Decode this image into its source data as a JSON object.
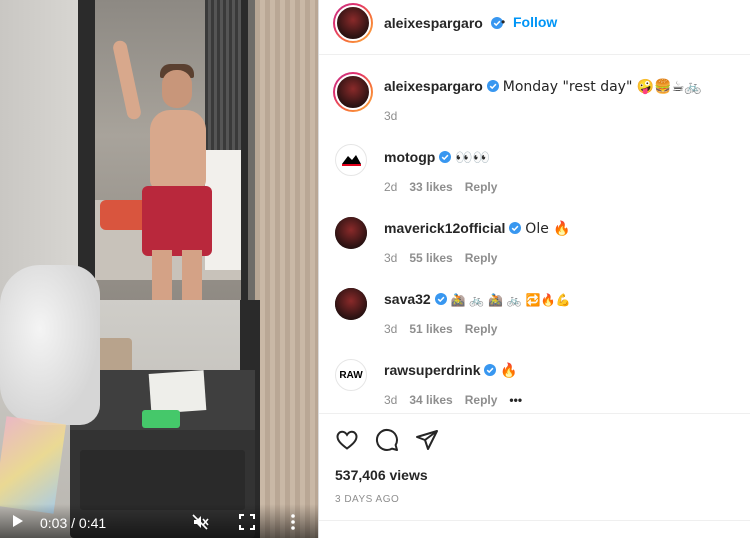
{
  "video": {
    "time": "0:03 / 0:41",
    "icons": [
      "play-icon",
      "muted-icon",
      "fullscreen-icon",
      "more-vertical-icon"
    ]
  },
  "header": {
    "username": "aleixespargaro",
    "separator": "•",
    "follow_label": "Follow"
  },
  "comments": [
    {
      "username": "aleixespargaro",
      "text": "Monday \"rest day\" 🤪🍔☕🚲",
      "age": "3d",
      "likes": "",
      "reply": ""
    },
    {
      "username": "motogp",
      "text": "👀👀",
      "age": "2d",
      "likes": "33 likes",
      "reply": "Reply"
    },
    {
      "username": "maverick12official",
      "text": "Ole 🔥",
      "age": "3d",
      "likes": "55 likes",
      "reply": "Reply"
    },
    {
      "username": "sava32",
      "text": "🚵 🚲 🚵 🚲 🔁🔥💪",
      "age": "3d",
      "likes": "51 likes",
      "reply": "Reply"
    },
    {
      "username": "rawsuperdrink",
      "text": "🔥",
      "age": "3d",
      "likes": "34 likes",
      "reply": "Reply",
      "more": "•••"
    }
  ],
  "actions": {
    "icons": [
      "heart-icon",
      "comment-icon",
      "share-icon"
    ],
    "views": "537,406 views",
    "posted": "3 DAYS AGO"
  },
  "avatar_logos": {
    "motogp": "motogp-logo",
    "rawsuperdrink": "RAW"
  },
  "colors": {
    "link": "#0095f6",
    "verified": "#3897f0",
    "muted_text": "#8e8e8e"
  }
}
